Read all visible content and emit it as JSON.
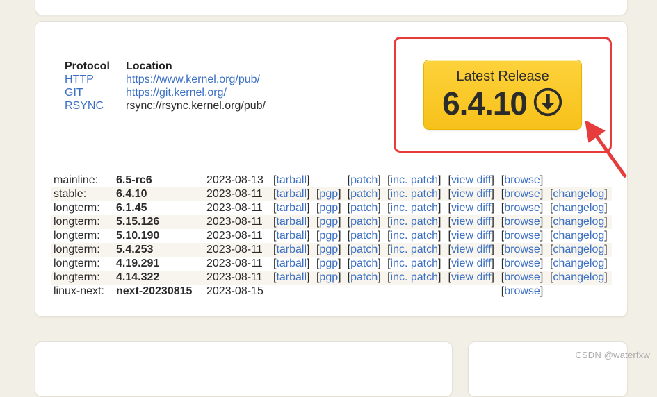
{
  "protocol": {
    "header": {
      "col1": "Protocol",
      "col2": "Location"
    },
    "rows": [
      {
        "name": "HTTP",
        "loc": "https://www.kernel.org/pub/",
        "name_link": true,
        "loc_link": true
      },
      {
        "name": "GIT",
        "loc": "https://git.kernel.org/",
        "name_link": true,
        "loc_link": true
      },
      {
        "name": "RSYNC",
        "loc": "rsync://rsync.kernel.org/pub/",
        "name_link": true,
        "loc_link": false
      }
    ]
  },
  "release": {
    "label": "Latest Release",
    "version": "6.4.10"
  },
  "link_labels": {
    "tarball": "tarball",
    "pgp": "pgp",
    "patch": "patch",
    "incpatch": "inc. patch",
    "viewdiff": "view diff",
    "browse": "browse",
    "changelog": "changelog"
  },
  "releases": [
    {
      "branch": "mainline:",
      "version": "6.5-rc6",
      "date": "2023-08-13",
      "tarball": true,
      "pgp": false,
      "patch": true,
      "incpatch": true,
      "viewdiff": true,
      "browse": true,
      "changelog": false
    },
    {
      "branch": "stable:",
      "version": "6.4.10",
      "date": "2023-08-11",
      "tarball": true,
      "pgp": true,
      "patch": true,
      "incpatch": true,
      "viewdiff": true,
      "browse": true,
      "changelog": true
    },
    {
      "branch": "longterm:",
      "version": "6.1.45",
      "date": "2023-08-11",
      "tarball": true,
      "pgp": true,
      "patch": true,
      "incpatch": true,
      "viewdiff": true,
      "browse": true,
      "changelog": true
    },
    {
      "branch": "longterm:",
      "version": "5.15.126",
      "date": "2023-08-11",
      "tarball": true,
      "pgp": true,
      "patch": true,
      "incpatch": true,
      "viewdiff": true,
      "browse": true,
      "changelog": true
    },
    {
      "branch": "longterm:",
      "version": "5.10.190",
      "date": "2023-08-11",
      "tarball": true,
      "pgp": true,
      "patch": true,
      "incpatch": true,
      "viewdiff": true,
      "browse": true,
      "changelog": true
    },
    {
      "branch": "longterm:",
      "version": "5.4.253",
      "date": "2023-08-11",
      "tarball": true,
      "pgp": true,
      "patch": true,
      "incpatch": true,
      "viewdiff": true,
      "browse": true,
      "changelog": true
    },
    {
      "branch": "longterm:",
      "version": "4.19.291",
      "date": "2023-08-11",
      "tarball": true,
      "pgp": true,
      "patch": true,
      "incpatch": true,
      "viewdiff": true,
      "browse": true,
      "changelog": true
    },
    {
      "branch": "longterm:",
      "version": "4.14.322",
      "date": "2023-08-11",
      "tarball": true,
      "pgp": true,
      "patch": true,
      "incpatch": true,
      "viewdiff": true,
      "browse": true,
      "changelog": true
    },
    {
      "branch": "linux-next:",
      "version": "next-20230815",
      "date": "2023-08-15",
      "tarball": false,
      "pgp": false,
      "patch": false,
      "incpatch": false,
      "viewdiff": false,
      "browse": true,
      "changelog": false
    }
  ],
  "watermark": "CSDN @waterfxw"
}
